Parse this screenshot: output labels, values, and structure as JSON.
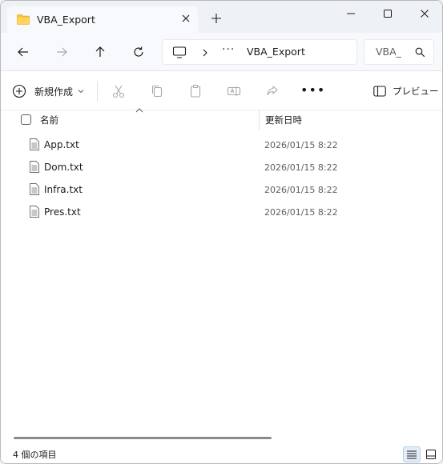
{
  "window": {
    "tab_title": "VBA_Export",
    "tab_icon": "folder-icon"
  },
  "navigation": {
    "address_more": "···",
    "address_path": "VBA_Export",
    "search_placeholder": "VBA_"
  },
  "toolbar": {
    "new_label": "新規作成",
    "more_label": "•••",
    "preview_label": "プレビュー"
  },
  "columns": {
    "name": "名前",
    "modified": "更新日時"
  },
  "files": [
    {
      "name": "App.txt",
      "modified": "2026/01/15 8:22"
    },
    {
      "name": "Dom.txt",
      "modified": "2026/01/15 8:22"
    },
    {
      "name": "Infra.txt",
      "modified": "2026/01/15 8:22"
    },
    {
      "name": "Pres.txt",
      "modified": "2026/01/15 8:22"
    }
  ],
  "status": {
    "item_count": "4 個の項目"
  },
  "colors": {
    "folder": "#ffc83d",
    "accent": "#1f6fd1",
    "chrome_bg": "#eef2f7"
  }
}
